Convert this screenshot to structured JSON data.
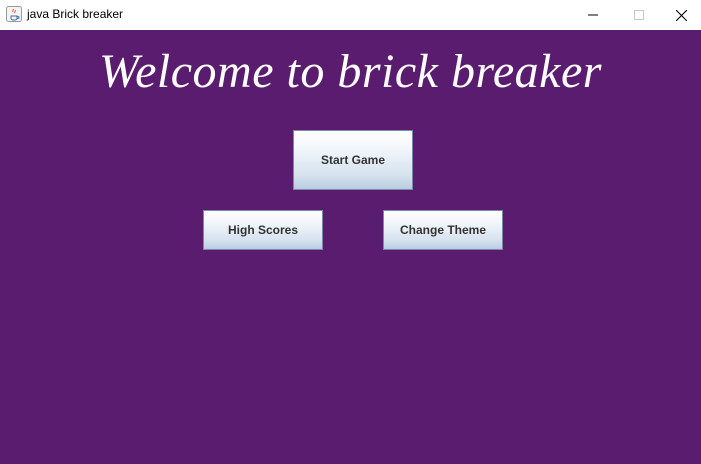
{
  "window": {
    "title": "java Brick breaker",
    "controls": {
      "minimize_icon": "minimize-icon",
      "maximize_icon": "maximize-icon",
      "close_icon": "close-icon"
    }
  },
  "main": {
    "headline": "Welcome to brick breaker",
    "buttons": {
      "start": "Start Game",
      "high_scores": "High Scores",
      "change_theme": "Change Theme"
    }
  },
  "colors": {
    "background": "#5a1c6f",
    "headline": "#ffffff",
    "button_text": "#333333"
  }
}
